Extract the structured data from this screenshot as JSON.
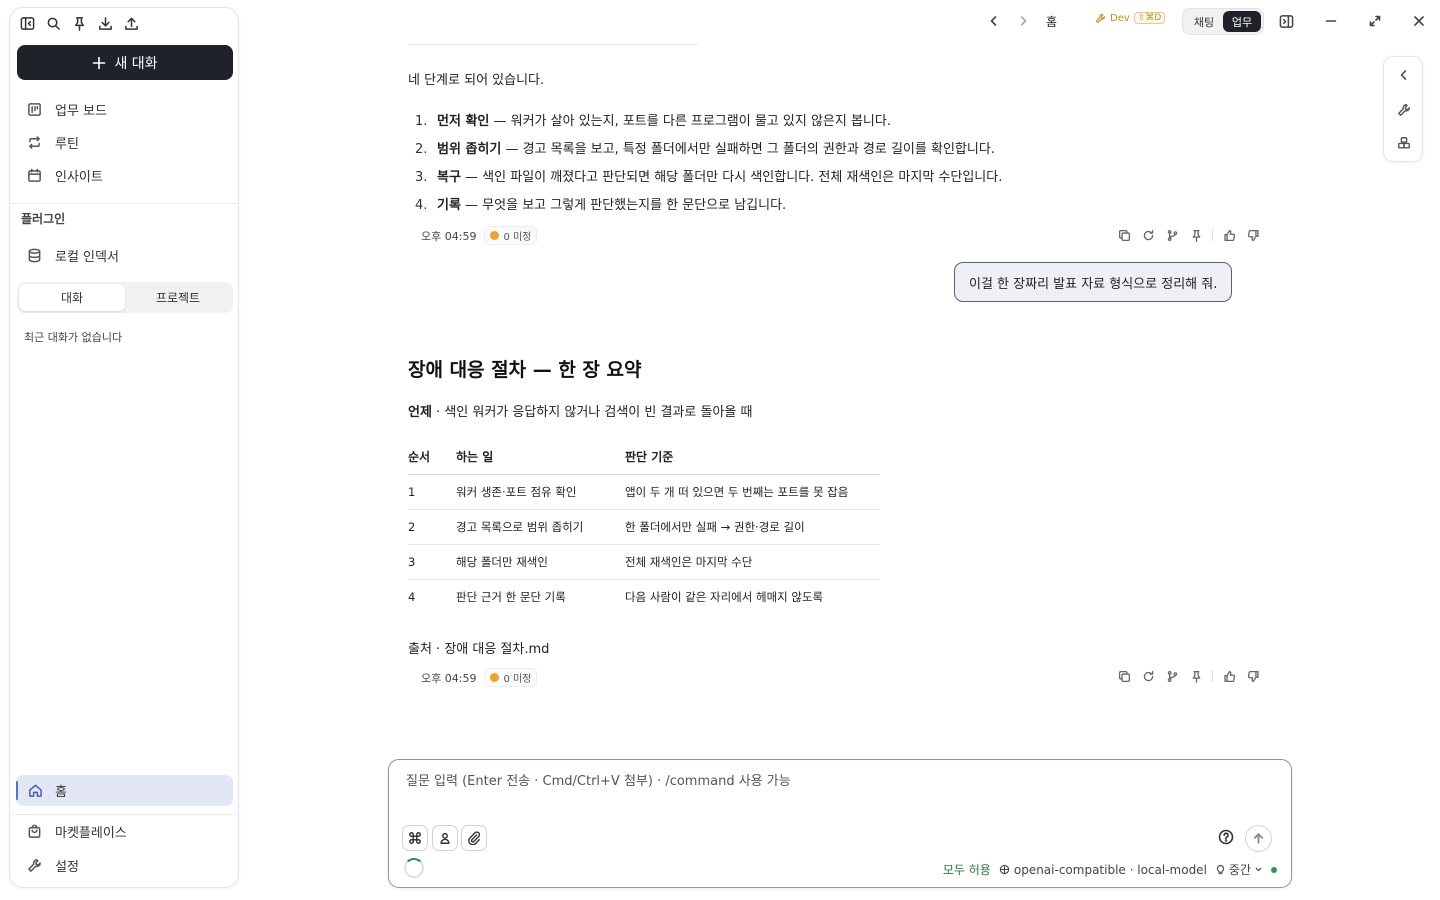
{
  "sidebar": {
    "new_chat_label": "새 대화",
    "nav": [
      {
        "label": "업무 보드",
        "icon": "board-icon"
      },
      {
        "label": "루틴",
        "icon": "repeat-icon"
      },
      {
        "label": "인사이트",
        "icon": "calendar-icon"
      }
    ],
    "plugins_heading": "플러그인",
    "plugin_items": [
      {
        "label": "로컬 인덱서",
        "icon": "database-icon"
      }
    ],
    "tabs": [
      "대화",
      "프로젝트"
    ],
    "active_tab": "대화",
    "empty_text": "최근 대화가 없습니다",
    "home_label": "홈",
    "marketplace_label": "마켓플레이스",
    "settings_label": "설정"
  },
  "topbar": {
    "home_label": "홈",
    "dev_label": "Dev",
    "dev_shortcut": "⇧⌘D",
    "modes": [
      "채팅",
      "업무"
    ],
    "active_mode": "업무"
  },
  "conversation": {
    "intro": "네 단계로 되어 있습니다.",
    "steps": [
      {
        "num": "1.",
        "title": "먼저 확인",
        "text": " — 워커가 살아 있는지, 포트를 다른 프로그램이 물고 있지 않은지 봅니다."
      },
      {
        "num": "2.",
        "title": "범위 좁히기",
        "text": " — 경고 목록을 보고, 특정 폴더에서만 실패하면 그 폴더의 권한과 경로 길이를 확인합니다."
      },
      {
        "num": "3.",
        "title": "복구",
        "text": " — 색인 파일이 깨졌다고 판단되면 해당 폴더만 다시 색인합니다. 전체 재색인은 마지막 수단입니다."
      },
      {
        "num": "4.",
        "title": "기록",
        "text": " — 무엇을 보고 그렇게 판단했는지를 한 문단으로 남깁니다."
      }
    ],
    "meta1": {
      "time": "오후 04:59",
      "badge": "0 미정"
    },
    "user_message": "이걸 한 장짜리 발표 자료 형식으로 정리해 줘.",
    "doc_title": "장애 대응 절차 — 한 장 요약",
    "context_label": "언제",
    "context_text": " · 색인 워커가 응답하지 않거나 검색이 빈 결과로 돌아올 때",
    "table": {
      "headers": [
        "순서",
        "하는 일",
        "판단 기준"
      ],
      "rows": [
        [
          "1",
          "워커 생존·포트 점유 확인",
          "앱이 두 개 떠 있으면 두 번째는 포트를 못 잡음"
        ],
        [
          "2",
          "경고 목록으로 범위 좁히기",
          "한 폴더에서만 실패 → 권한·경로 길이"
        ],
        [
          "3",
          "해당 폴더만 재색인",
          "전체 재색인은 마지막 수단"
        ],
        [
          "4",
          "판단 근거 한 문단 기록",
          "다음 사람이 같은 자리에서 헤매지 않도록"
        ]
      ]
    },
    "source": "출처 · 장애 대응 절차.md",
    "meta2": {
      "time": "오후 04:59",
      "badge": "0 미정"
    }
  },
  "composer": {
    "placeholder": "질문 입력 (Enter 전송 · Cmd/Ctrl+V 첨부) · /command 사용 가능",
    "permission": "모두 허용",
    "model": "openai-compatible · local-model",
    "effort": "중간"
  },
  "colors": {
    "accent": "#1f2329",
    "status_green": "#2f9a4f",
    "badge_orange": "#f0a22a",
    "home_highlight": "#e2e6f5"
  }
}
